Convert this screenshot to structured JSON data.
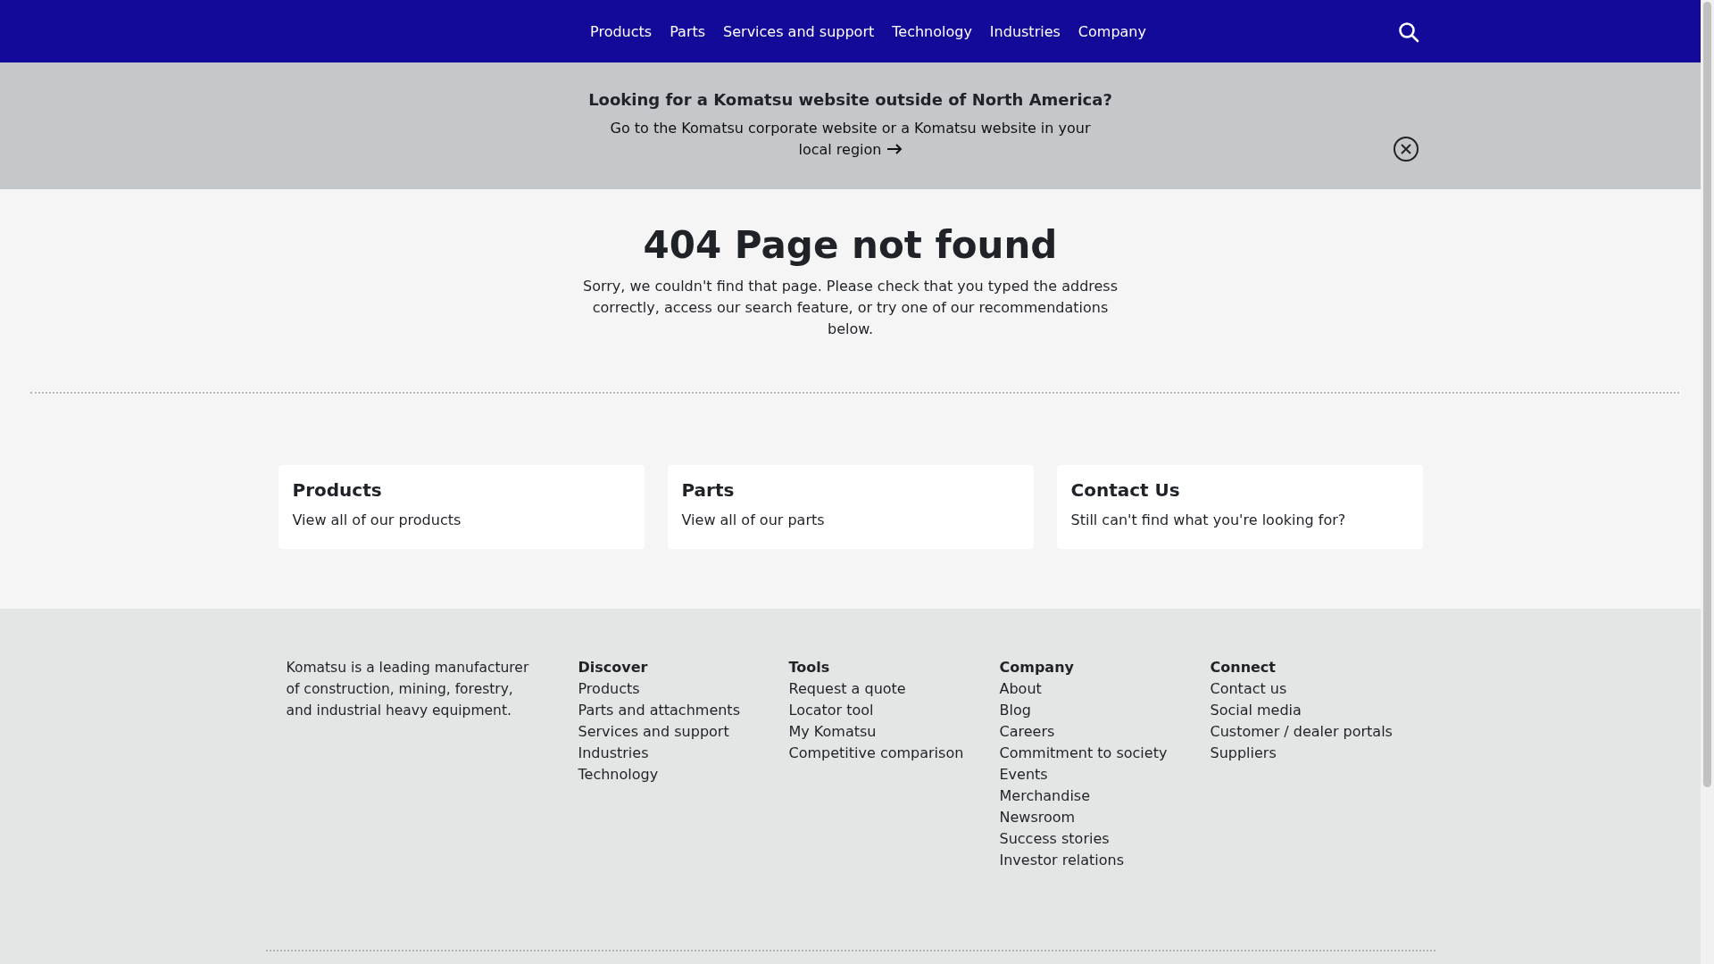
{
  "nav": {
    "items": [
      {
        "label": "Products"
      },
      {
        "label": "Parts"
      },
      {
        "label": "Services and support"
      },
      {
        "label": "Technology"
      },
      {
        "label": "Industries"
      },
      {
        "label": "Company"
      }
    ]
  },
  "banner": {
    "title": "Looking for a Komatsu website outside of North America?",
    "text": "Go to the Komatsu corporate website or a Komatsu website in your local region"
  },
  "error": {
    "title": "404 Page not found",
    "text": "Sorry, we couldn't find that page. Please check that you typed the address correctly, access our search feature, or try one of our recommendations below."
  },
  "cards": [
    {
      "title": "Products",
      "text": "View all of our products"
    },
    {
      "title": "Parts",
      "text": "View all of our parts"
    },
    {
      "title": "Contact Us",
      "text": "Still can't find what you're looking for?"
    }
  ],
  "footer": {
    "about": "Komatsu is a leading manufacturer of construction, mining, forestry, and industrial heavy equipment.",
    "columns": [
      {
        "heading": "Discover",
        "links": [
          "Products",
          "Parts and attachments",
          "Services and support",
          "Industries",
          "Technology"
        ]
      },
      {
        "heading": "Tools",
        "links": [
          "Request a quote",
          "Locator tool",
          "My Komatsu",
          "Competitive comparison"
        ]
      },
      {
        "heading": "Company",
        "links": [
          "About",
          "Blog",
          "Careers",
          "Commitment to society",
          "Events",
          "Merchandise",
          "Newsroom",
          "Success stories",
          "Investor relations"
        ]
      },
      {
        "heading": "Connect",
        "links": [
          "Contact us",
          "Social media",
          "Customer / dealer portals",
          "Suppliers"
        ]
      }
    ]
  }
}
